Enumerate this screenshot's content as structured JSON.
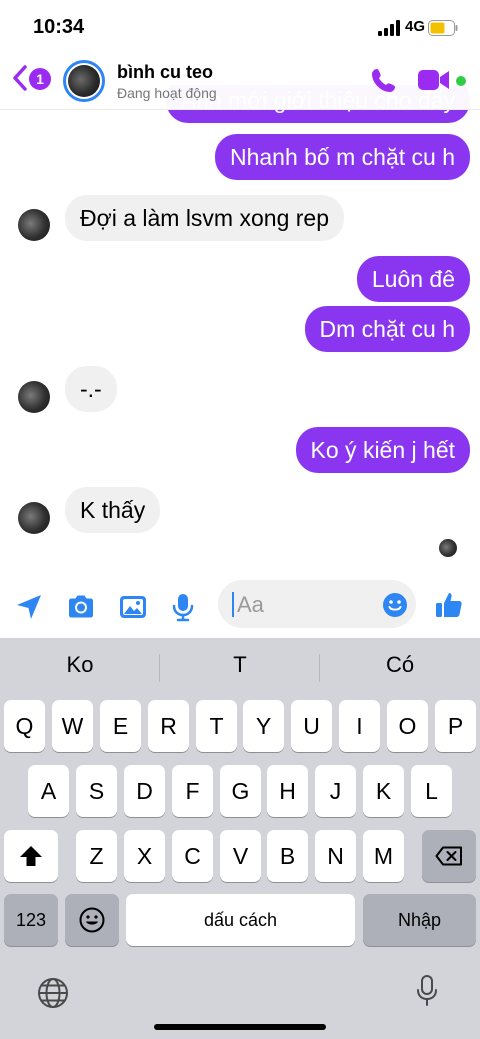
{
  "status_bar": {
    "time": "10:34",
    "network": "4G"
  },
  "header": {
    "back_badge": "1",
    "contact_name": "bình cu teo",
    "contact_status": "Đang hoạt động",
    "online_color": "#31cc46",
    "icons": {
      "back": "chevron-left-icon",
      "call": "phone-icon",
      "video": "video-camera-icon"
    }
  },
  "messages": [
    {
      "side": "out",
      "text": "Anh mới giới thiệu cho đấy"
    },
    {
      "side": "out",
      "text": "Nhanh bố m chặt cu h"
    },
    {
      "side": "in",
      "text": "Đợi a làm lsvm xong rep"
    },
    {
      "side": "out",
      "text": "Luôn đê"
    },
    {
      "side": "out",
      "text": "Dm chặt cu h"
    },
    {
      "side": "in",
      "text": "-.-"
    },
    {
      "side": "out",
      "text": "Ko ý kiến j hết"
    },
    {
      "side": "in",
      "text": "K thấy"
    }
  ],
  "composer": {
    "placeholder": "Aa",
    "icons": [
      "location-arrow-icon",
      "camera-icon",
      "image-icon",
      "microphone-icon",
      "emoji-icon",
      "thumbs-up-icon"
    ]
  },
  "keyboard": {
    "suggestions": [
      "Ko",
      "T",
      "Có"
    ],
    "row1": [
      "Q",
      "W",
      "E",
      "R",
      "T",
      "Y",
      "U",
      "I",
      "O",
      "P"
    ],
    "row2": [
      "A",
      "S",
      "D",
      "F",
      "G",
      "H",
      "J",
      "K",
      "L"
    ],
    "row3": [
      "Z",
      "X",
      "C",
      "V",
      "B",
      "N",
      "M"
    ],
    "numbers_key": "123",
    "space_key": "dấu cách",
    "return_key": "Nhập"
  },
  "colors": {
    "accent": "#8a36f0",
    "blue": "#2e86f3",
    "incoming": "#f0f0f0"
  }
}
